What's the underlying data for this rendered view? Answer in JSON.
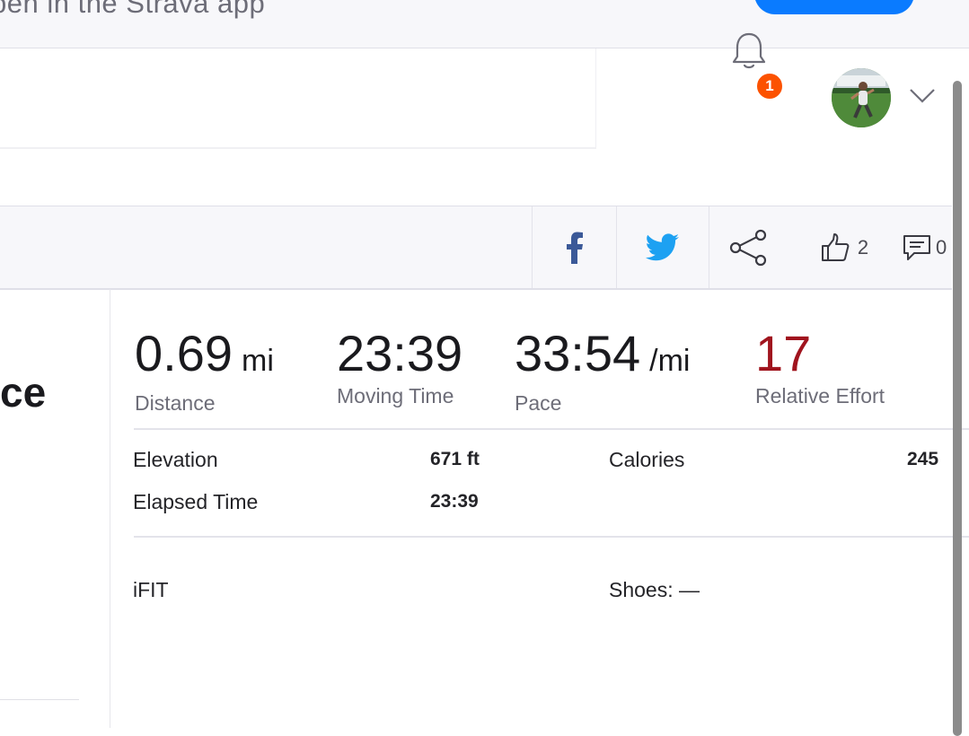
{
  "banner": {
    "text": "pen in the Strava app"
  },
  "header": {
    "notifications_count": "1",
    "icons": {
      "bell": "bell-icon",
      "chevron": "chevron-down-icon"
    }
  },
  "share": {
    "kudos_count": "2",
    "comments_count": "0",
    "icons": [
      "facebook-icon",
      "twitter-icon",
      "share-icon",
      "thumbs-up-icon",
      "comment-icon"
    ]
  },
  "activity": {
    "title_fragment": "ce"
  },
  "stats": {
    "distance": {
      "value": "0.69",
      "unit": "mi",
      "label": "Distance"
    },
    "moving_time": {
      "value": "23:39",
      "label": "Moving Time"
    },
    "pace": {
      "value": "33:54",
      "unit": "/mi",
      "label": "Pace"
    },
    "relative_effort": {
      "value": "17",
      "label": "Relative Effort"
    }
  },
  "details": {
    "elevation_label": "Elevation",
    "elevation_value": "671 ft",
    "calories_label": "Calories",
    "calories_value": "245",
    "elapsed_label": "Elapsed Time",
    "elapsed_value": "23:39"
  },
  "device": {
    "name": "iFIT",
    "shoes": "Shoes: —"
  },
  "colors": {
    "brand_orange": "#fc5200",
    "effort_red": "#a0141e",
    "button_blue": "#0a7bff",
    "facebook_blue": "#3b5998",
    "twitter_blue": "#1da1f2"
  }
}
